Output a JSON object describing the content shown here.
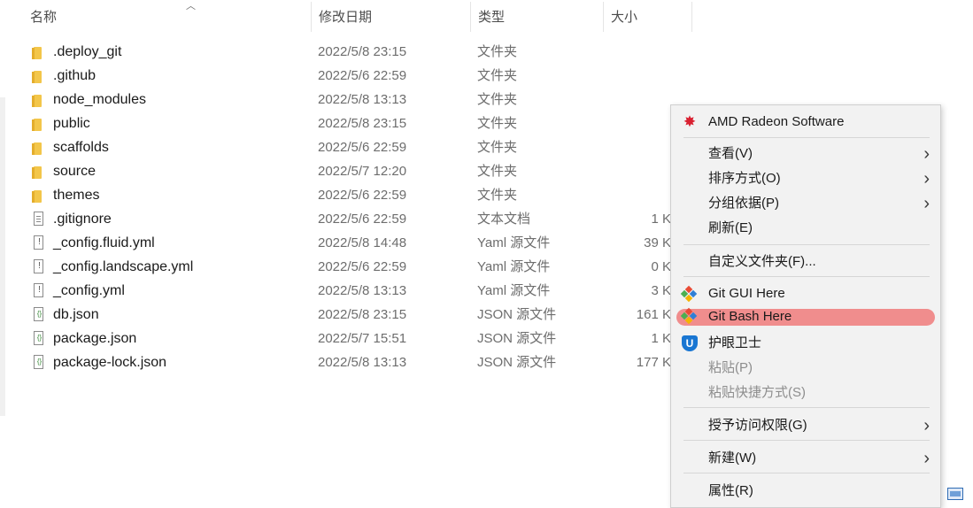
{
  "columns": {
    "name": "名称",
    "modified": "修改日期",
    "type": "类型",
    "size": "大小"
  },
  "files": [
    {
      "name": ".deploy_git",
      "modified": "2022/5/8 23:15",
      "type": "文件夹",
      "size": "",
      "icon": "folder-icon"
    },
    {
      "name": ".github",
      "modified": "2022/5/6 22:59",
      "type": "文件夹",
      "size": "",
      "icon": "folder-icon"
    },
    {
      "name": "node_modules",
      "modified": "2022/5/8 13:13",
      "type": "文件夹",
      "size": "",
      "icon": "folder-icon"
    },
    {
      "name": "public",
      "modified": "2022/5/8 23:15",
      "type": "文件夹",
      "size": "",
      "icon": "folder-icon"
    },
    {
      "name": "scaffolds",
      "modified": "2022/5/6 22:59",
      "type": "文件夹",
      "size": "",
      "icon": "folder-icon"
    },
    {
      "name": "source",
      "modified": "2022/5/7 12:20",
      "type": "文件夹",
      "size": "",
      "icon": "folder-icon"
    },
    {
      "name": "themes",
      "modified": "2022/5/6 22:59",
      "type": "文件夹",
      "size": "",
      "icon": "folder-icon"
    },
    {
      "name": ".gitignore",
      "modified": "2022/5/6 22:59",
      "type": "文本文档",
      "size": "1 K",
      "icon": "text-file-icon"
    },
    {
      "name": "_config.fluid.yml",
      "modified": "2022/5/8 14:48",
      "type": "Yaml 源文件",
      "size": "39 K",
      "icon": "yaml-file-icon"
    },
    {
      "name": "_config.landscape.yml",
      "modified": "2022/5/6 22:59",
      "type": "Yaml 源文件",
      "size": "0 K",
      "icon": "yaml-file-icon"
    },
    {
      "name": "_config.yml",
      "modified": "2022/5/8 13:13",
      "type": "Yaml 源文件",
      "size": "3 K",
      "icon": "yaml-file-icon"
    },
    {
      "name": "db.json",
      "modified": "2022/5/8 23:15",
      "type": "JSON 源文件",
      "size": "161 K",
      "icon": "json-file-icon"
    },
    {
      "name": "package.json",
      "modified": "2022/5/7 15:51",
      "type": "JSON 源文件",
      "size": "1 K",
      "icon": "json-file-icon"
    },
    {
      "name": "package-lock.json",
      "modified": "2022/5/8 13:13",
      "type": "JSON 源文件",
      "size": "177 K",
      "icon": "json-file-icon"
    }
  ],
  "context_menu": {
    "items": [
      {
        "label": "AMD Radeon Software",
        "icon": "amd-radeon-icon"
      },
      {
        "label": "查看(V)",
        "submenu": true
      },
      {
        "label": "排序方式(O)",
        "submenu": true
      },
      {
        "label": "分组依据(P)",
        "submenu": true
      },
      {
        "label": "刷新(E)"
      },
      {
        "label": "自定义文件夹(F)..."
      },
      {
        "label": "Git GUI Here",
        "icon": "git-gui-icon"
      },
      {
        "label": "Git Bash Here",
        "icon": "git-bash-icon",
        "highlighted": true
      },
      {
        "label": "护眼卫士",
        "icon": "eye-guard-icon"
      },
      {
        "label": "粘贴(P)",
        "disabled": true
      },
      {
        "label": "粘贴快捷方式(S)",
        "disabled": true
      },
      {
        "label": "授予访问权限(G)",
        "submenu": true
      },
      {
        "label": "新建(W)",
        "submenu": true
      },
      {
        "label": "属性(R)"
      }
    ]
  },
  "colors": {
    "highlight": "#f08d8d",
    "folder": "#f3c64a",
    "amd": "#d92030",
    "shield": "#1976d2"
  }
}
